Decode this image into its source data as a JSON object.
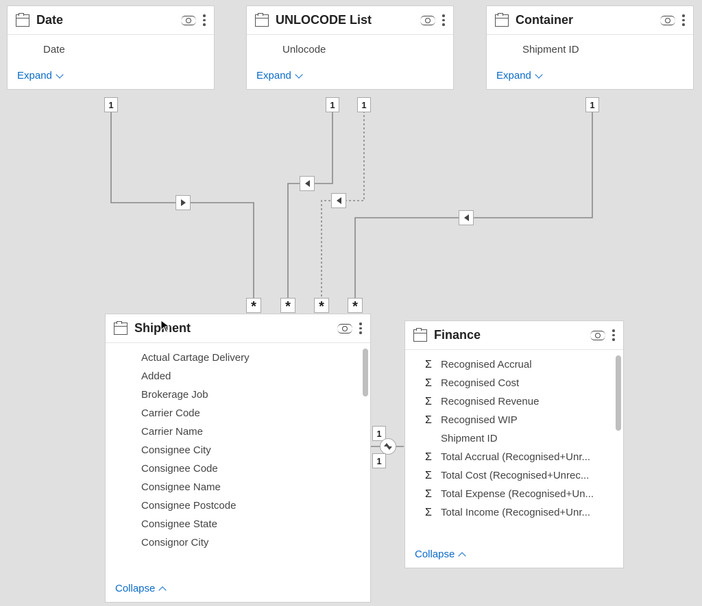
{
  "ui": {
    "expand": "Expand",
    "collapse": "Collapse"
  },
  "cards": {
    "date": {
      "title": "Date",
      "fields": [
        "Date"
      ]
    },
    "unlocode": {
      "title": "UNLOCODE List",
      "fields": [
        "Unlocode"
      ]
    },
    "container": {
      "title": "Container",
      "fields": [
        "Shipment ID"
      ]
    },
    "shipment": {
      "title": "Shipment",
      "fields": [
        "Actual Cartage Delivery",
        "Added",
        "Brokerage Job",
        "Carrier Code",
        "Carrier Name",
        "Consignee City",
        "Consignee Code",
        "Consignee Name",
        "Consignee Postcode",
        "Consignee State",
        "Consignor City"
      ]
    },
    "finance": {
      "title": "Finance",
      "fields": [
        {
          "type": "sum",
          "label": "Recognised Accrual"
        },
        {
          "type": "sum",
          "label": "Recognised Cost"
        },
        {
          "type": "sum",
          "label": "Recognised Revenue"
        },
        {
          "type": "sum",
          "label": "Recognised WIP"
        },
        {
          "type": "plain",
          "label": "Shipment ID"
        },
        {
          "type": "sum",
          "label": "Total Accrual (Recognised+Unr..."
        },
        {
          "type": "sum",
          "label": "Total Cost (Recognised+Unrec..."
        },
        {
          "type": "sum",
          "label": "Total Expense (Recognised+Un..."
        },
        {
          "type": "sum",
          "label": "Total Income (Recognised+Unr..."
        }
      ]
    }
  },
  "relationships": {
    "date_shipment": {
      "from": "1",
      "to": "*"
    },
    "unlocode_shipment_a": {
      "from": "1",
      "to": "*"
    },
    "unlocode_shipment_b": {
      "from": "1",
      "to": "*"
    },
    "container_shipment": {
      "from": "1",
      "to": "*"
    },
    "shipment_finance": {
      "from": "1",
      "to": "1"
    }
  }
}
